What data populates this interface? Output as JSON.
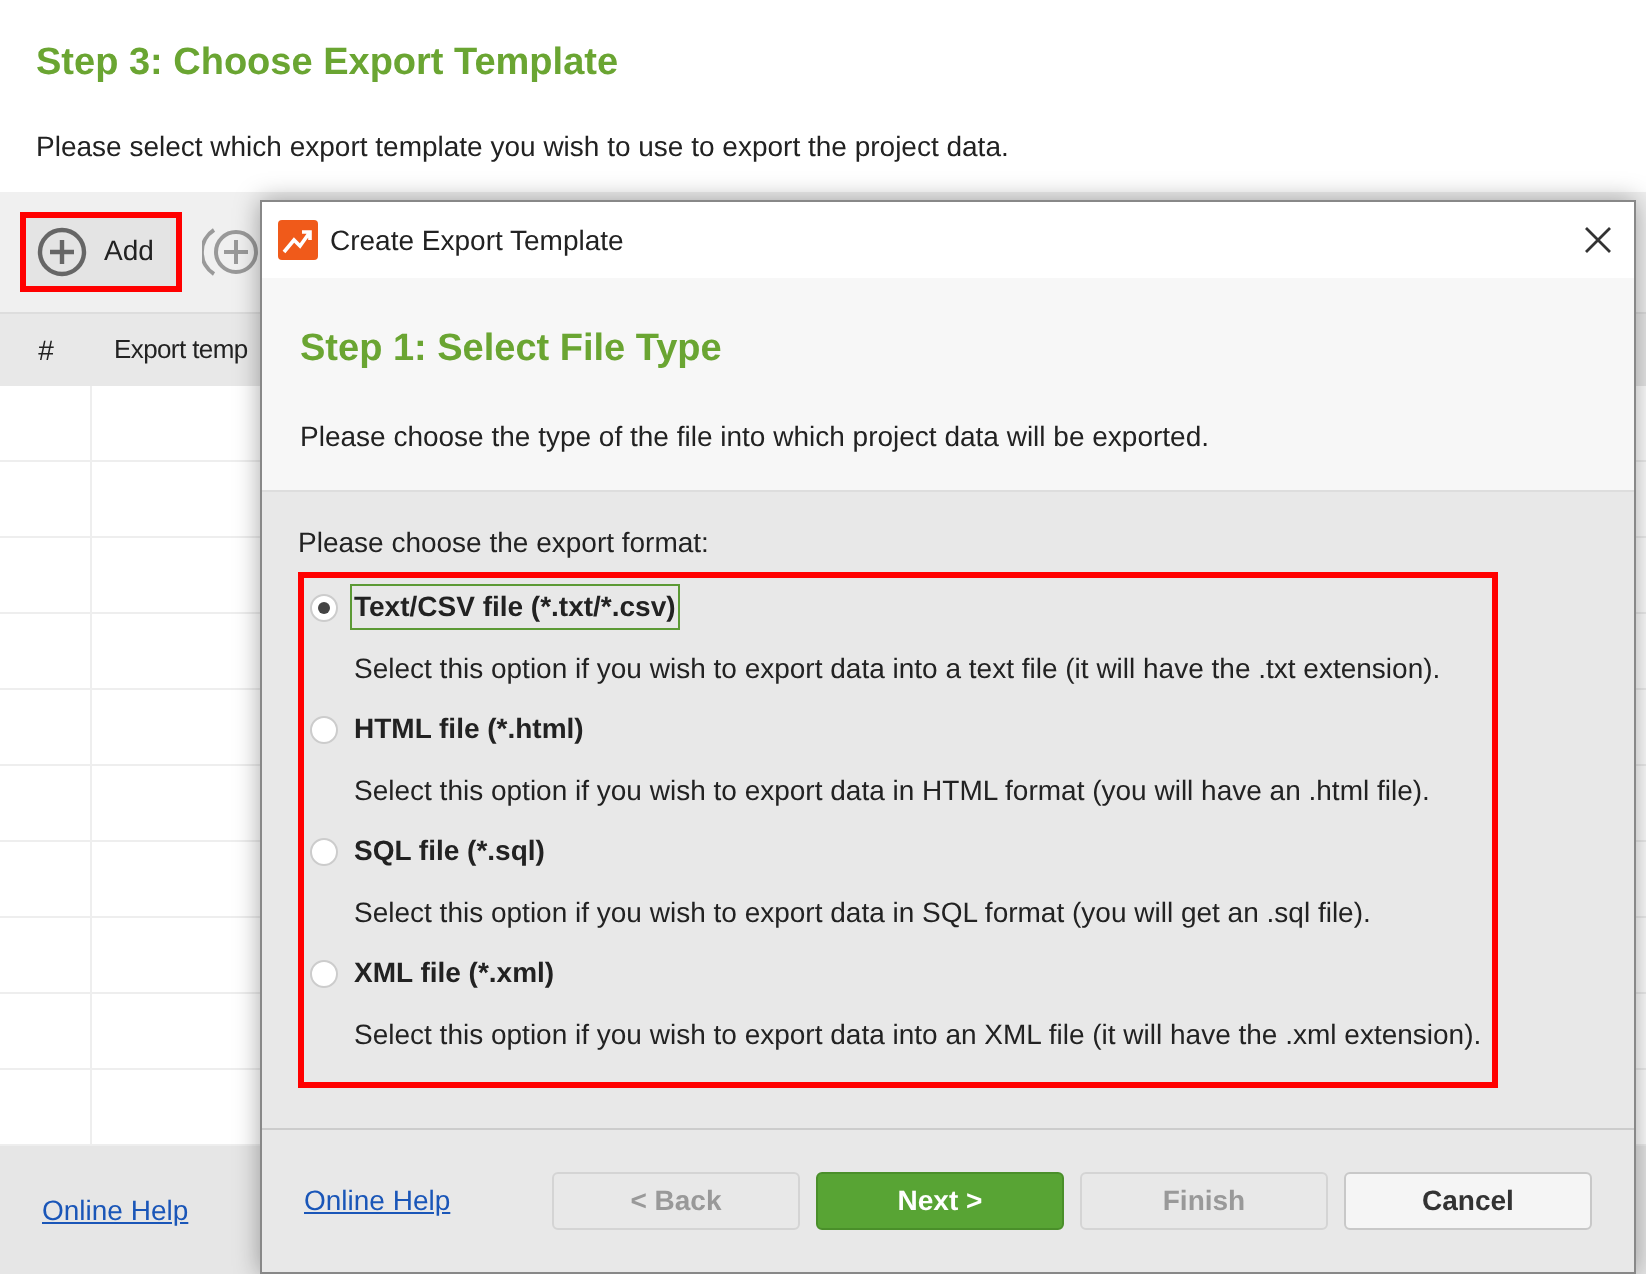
{
  "page": {
    "title": "Step 3: Choose Export Template",
    "description": "Please select which export template you wish to use to export the project data.",
    "toolbar": [
      {
        "label": "Add",
        "highlighted": true
      }
    ],
    "table": {
      "columns": [
        "#",
        "Export temp"
      ]
    },
    "footer_link": "Online Help"
  },
  "dialog": {
    "title": "Create Export Template",
    "step_title": "Step 1: Select File Type",
    "step_description": "Please choose the type of the file into which project data will be exported.",
    "prompt": "Please choose the export format:",
    "options": [
      {
        "label": "Text/CSV file (*.txt/*.csv)",
        "description": "Select this option if you wish to export data into a text file (it will have the .txt extension).",
        "selected": true
      },
      {
        "label": "HTML file (*.html)",
        "description": "Select this option if you wish to export data in HTML format (you will have an .html file).",
        "selected": false
      },
      {
        "label": "SQL file (*.sql)",
        "description": "Select this option if you wish to export data in SQL format (you will get an .sql file).",
        "selected": false
      },
      {
        "label": "XML file (*.xml)",
        "description": "Select this option if you wish to export data into an XML file (it will have the .xml extension).",
        "selected": false
      }
    ],
    "footer_link": "Online Help",
    "buttons": [
      {
        "label": "< Back",
        "kind": "normal",
        "disabled": true
      },
      {
        "label": "Next >",
        "kind": "primary",
        "disabled": false
      },
      {
        "label": "Finish",
        "kind": "normal",
        "disabled": true
      },
      {
        "label": "Cancel",
        "kind": "normal",
        "disabled": false
      }
    ]
  }
}
